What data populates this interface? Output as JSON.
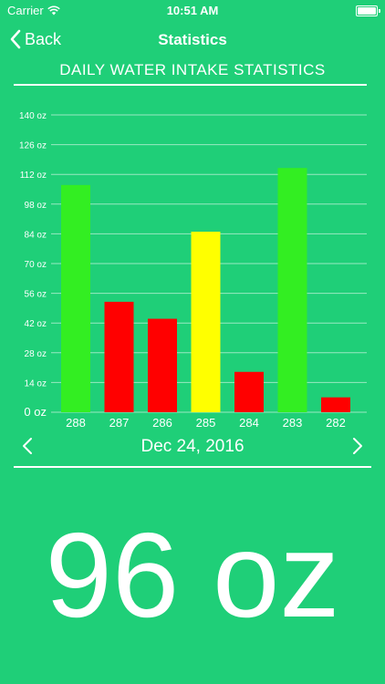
{
  "status_bar": {
    "carrier": "Carrier",
    "time": "10:51 AM",
    "icons": [
      "wifi-icon",
      "battery-icon"
    ]
  },
  "nav": {
    "back_label": "Back",
    "title": "Statistics",
    "back_icon": "chevron-left-icon"
  },
  "section": {
    "title": "DAILY WATER INTAKE STATISTICS"
  },
  "chart_data": {
    "type": "bar",
    "title": "",
    "xlabel": "",
    "ylabel": "",
    "ylim": [
      0,
      140
    ],
    "y_ticks": [
      "0 oz",
      "14 oz",
      "28 oz",
      "42 oz",
      "56 oz",
      "70 oz",
      "84 oz",
      "98 oz",
      "112 oz",
      "126 oz",
      "140 oz"
    ],
    "categories": [
      "288",
      "287",
      "286",
      "285",
      "284",
      "283",
      "282"
    ],
    "values": [
      107,
      52,
      44,
      85,
      19,
      115,
      7
    ],
    "bar_colors": [
      "#33ee22",
      "#ff0000",
      "#ff0000",
      "#ffff00",
      "#ff0000",
      "#33ee22",
      "#ff0000"
    ],
    "grid": true
  },
  "date_nav": {
    "date": "Dec 24, 2016",
    "prev_icon": "chevron-left-icon",
    "next_icon": "chevron-right-icon"
  },
  "summary": {
    "value": "96 oz"
  },
  "colors": {
    "background": "#1fcf78",
    "text": "#ffffff"
  }
}
